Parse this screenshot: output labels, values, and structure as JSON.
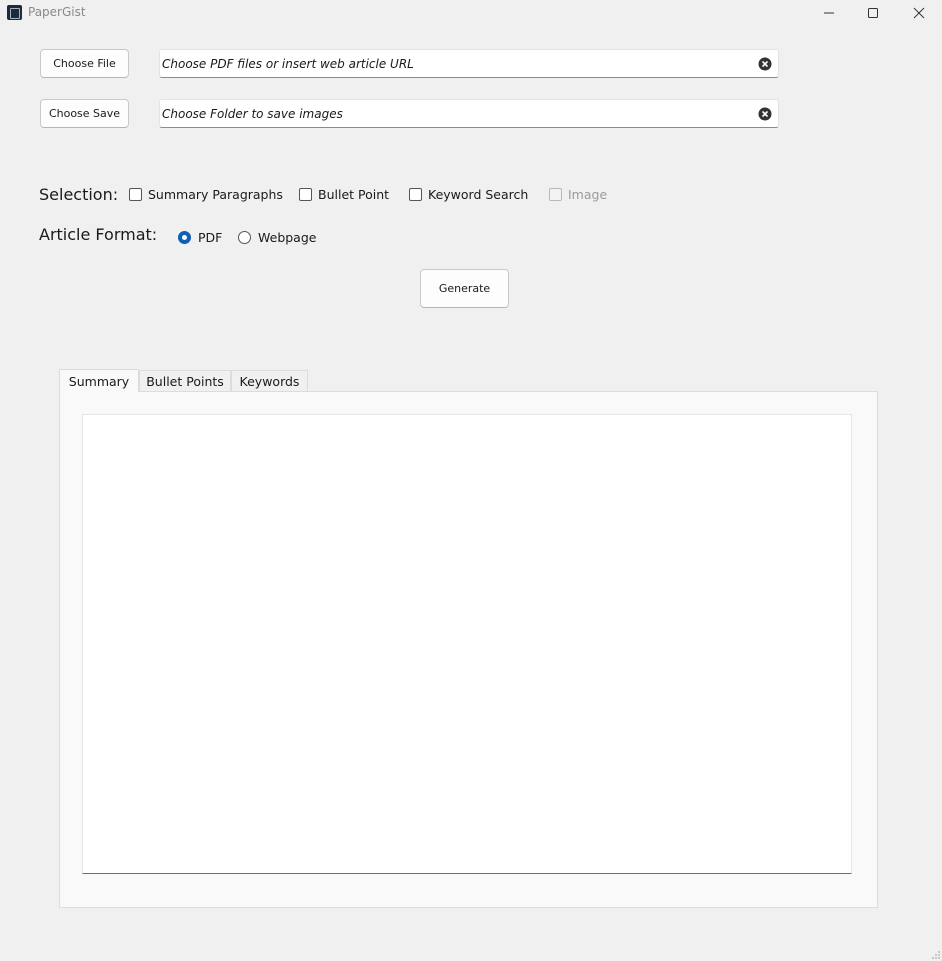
{
  "window": {
    "title": "PaperGist",
    "controls": [
      "minimize-icon",
      "maximize-icon",
      "close-icon"
    ]
  },
  "file_row": {
    "button_label": "Choose File",
    "placeholder": "Choose PDF files or insert web article URL",
    "value": ""
  },
  "save_row": {
    "button_label": "Choose Save",
    "placeholder": "Choose Folder to save images",
    "value": ""
  },
  "selection": {
    "label": "Selection:",
    "options": [
      {
        "label": "Summary Paragraphs",
        "checked": false,
        "enabled": true
      },
      {
        "label": "Bullet Point",
        "checked": false,
        "enabled": true
      },
      {
        "label": "Keyword Search",
        "checked": false,
        "enabled": true
      },
      {
        "label": "Image",
        "checked": false,
        "enabled": false
      }
    ]
  },
  "article_format": {
    "label": "Article Format:",
    "options": [
      {
        "label": "PDF",
        "selected": true
      },
      {
        "label": "Webpage",
        "selected": false
      }
    ]
  },
  "generate_label": "Generate",
  "tabs": [
    {
      "label": "Summary",
      "active": true
    },
    {
      "label": "Bullet Points",
      "active": false
    },
    {
      "label": "Keywords",
      "active": false
    }
  ],
  "output_text": "",
  "colors": {
    "background": "#f0f0f0",
    "accent": "#0f5fb5"
  }
}
